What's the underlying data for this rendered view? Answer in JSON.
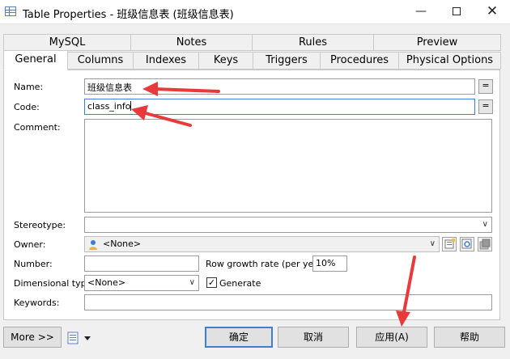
{
  "window": {
    "title": "Table Properties - 班级信息表 (班级信息表)"
  },
  "controls": {
    "minimize": "—",
    "close": "✕"
  },
  "tabs": {
    "row1": [
      "MySQL",
      "Notes",
      "Rules",
      "Preview"
    ],
    "row2": [
      "General",
      "Columns",
      "Indexes",
      "Keys",
      "Triggers",
      "Procedures",
      "Physical Options"
    ]
  },
  "form": {
    "name": {
      "label": "Name:",
      "value": "班级信息表"
    },
    "code": {
      "label": "Code:",
      "value": "class_info"
    },
    "comment": {
      "label": "Comment:",
      "value": ""
    },
    "stereotype": {
      "label": "Stereotype:",
      "value": ""
    },
    "owner": {
      "label": "Owner:",
      "value": "<None>"
    },
    "number": {
      "label": "Number:",
      "value": ""
    },
    "row_growth": {
      "label": "Row growth rate (per year):",
      "value": "10%"
    },
    "dimensional_type": {
      "label": "Dimensional type:",
      "value": "<None>"
    },
    "generate": {
      "label": "Generate",
      "checked": true
    },
    "keywords": {
      "label": "Keywords:",
      "value": ""
    },
    "eq_symbol": "="
  },
  "buttons": {
    "more": "More >>",
    "ok": "确定",
    "cancel": "取消",
    "apply": "应用(A)",
    "help": "帮助"
  },
  "colors": {
    "accent": "#3c7fd6",
    "annotation": "#e83a3a"
  },
  "icons": [
    "table-icon",
    "user-icon",
    "properties-icon",
    "browse-icon",
    "new-icon",
    "printer-icon"
  ]
}
